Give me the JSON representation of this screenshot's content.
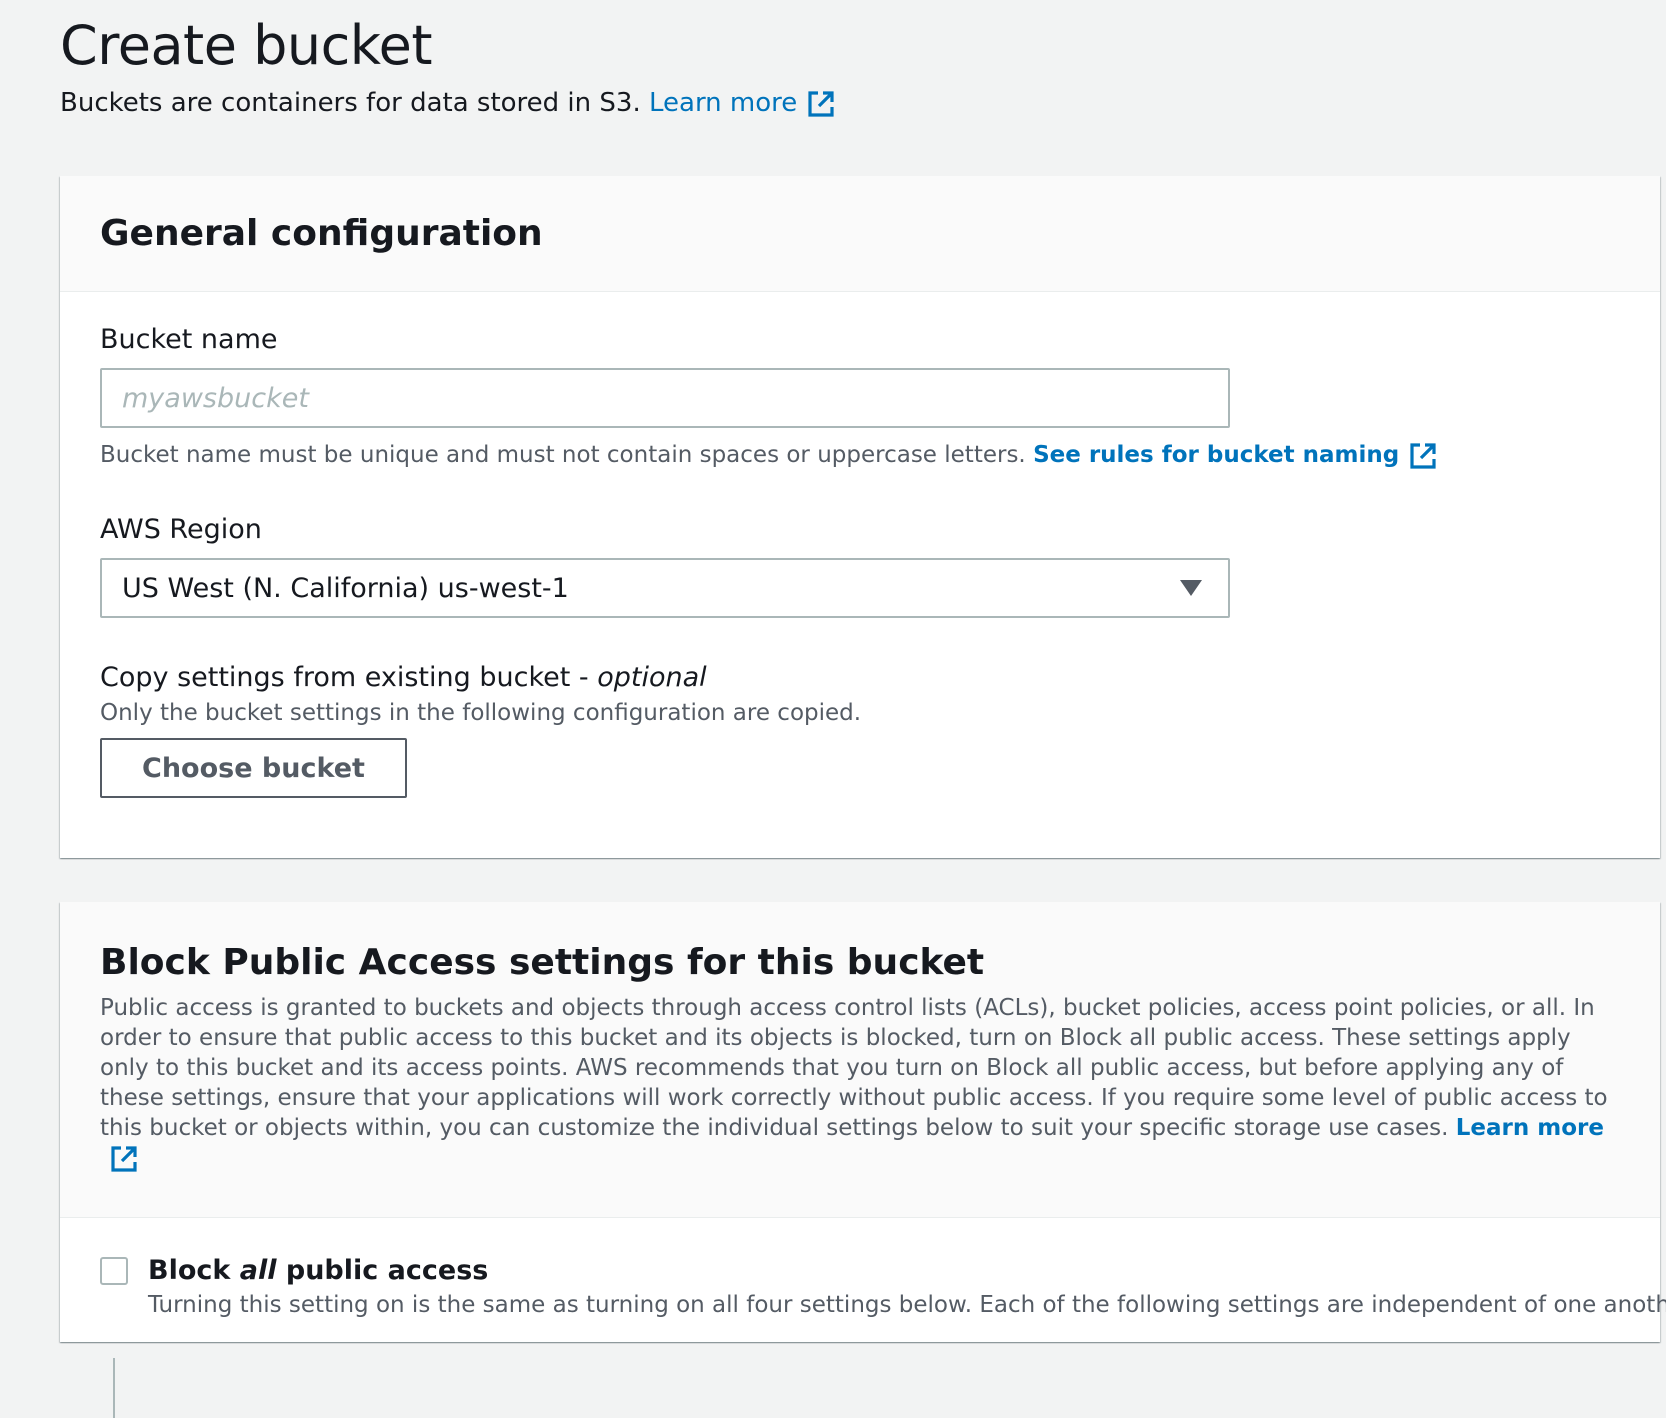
{
  "page": {
    "title": "Create bucket",
    "description": "Buckets are containers for data stored in S3.",
    "learn_more": "Learn more"
  },
  "general": {
    "title": "General configuration",
    "bucket_name": {
      "label": "Bucket name",
      "placeholder": "myawsbucket",
      "value": "",
      "hint": "Bucket name must be unique and must not contain spaces or uppercase letters.",
      "rules_link": "See rules for bucket naming"
    },
    "region": {
      "label": "AWS Region",
      "selected": "US West (N. California) us-west-1"
    },
    "copy": {
      "label": "Copy settings from existing bucket - ",
      "optional": "optional",
      "hint": "Only the bucket settings in the following configuration are copied.",
      "button": "Choose bucket"
    }
  },
  "block_public": {
    "title": "Block Public Access settings for this bucket",
    "description": "Public access is granted to buckets and objects through access control lists (ACLs), bucket policies, access point policies, or all. In order to ensure that public access to this bucket and its objects is blocked, turn on Block all public access. These settings apply only to this bucket and its access points. AWS recommends that you turn on Block all public access, but before applying any of these settings, ensure that your applications will work correctly without public access. If you require some level of public access to this bucket or objects within, you can customize the individual settings below to suit your specific storage use cases.",
    "learn_more": "Learn more",
    "block_all": {
      "label_pre": "Block ",
      "label_em": "all",
      "label_post": " public access",
      "hint": "Turning this setting on is the same as turning on all four settings below. Each of the following settings are independent of one another.",
      "checked": false
    }
  },
  "colors": {
    "link": "#0073bb",
    "background": "#f2f3f3",
    "border": "#aab7b8",
    "text": "#16191f",
    "secondary_text": "#545b64"
  },
  "icons": {
    "external_link": "external-link-icon",
    "dropdown": "caret-down-icon"
  }
}
